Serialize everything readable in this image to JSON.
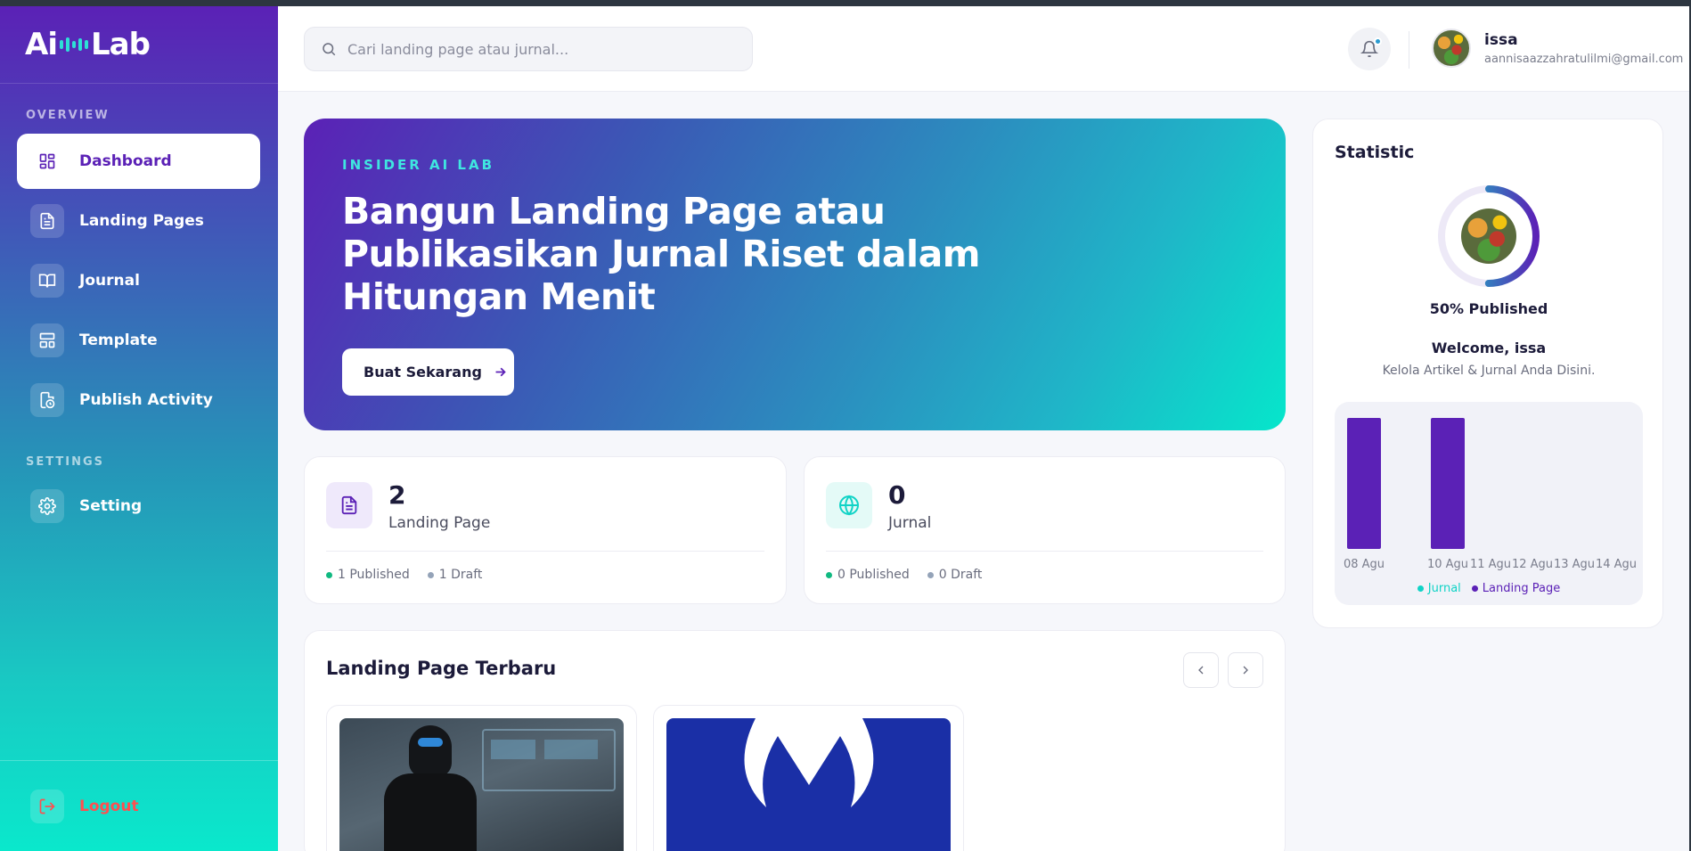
{
  "brand": {
    "name_left": "Ai",
    "name_right": "Lab"
  },
  "sidebar": {
    "overview_label": "OVERVIEW",
    "settings_label": "SETTINGS",
    "items": [
      {
        "label": "Dashboard",
        "icon": "grid-icon",
        "active": true
      },
      {
        "label": "Landing Pages",
        "icon": "file-text-icon"
      },
      {
        "label": "Journal",
        "icon": "book-open-icon"
      },
      {
        "label": "Template",
        "icon": "layout-icon"
      },
      {
        "label": "Publish Activity",
        "icon": "file-clock-icon"
      }
    ],
    "setting": {
      "label": "Setting",
      "icon": "gear-icon"
    },
    "logout": {
      "label": "Logout",
      "icon": "logout-icon"
    }
  },
  "header": {
    "search_placeholder": "Cari landing page atau jurnal...",
    "user": {
      "name": "issa",
      "email": "aannisaazzahratulilmi@gmail.com"
    }
  },
  "hero": {
    "kicker": "INSIDER AI LAB",
    "title": "Bangun Landing Page atau Publikasikan Jurnal Riset dalam Hitungan Menit",
    "button": "Buat Sekarang"
  },
  "stats": [
    {
      "count": "2",
      "label": "Landing Page",
      "published": "1 Published",
      "draft": "1 Draft"
    },
    {
      "count": "0",
      "label": "Jurnal",
      "published": "0 Published",
      "draft": "0 Draft"
    }
  ],
  "latest": {
    "title": "Landing Page Terbaru"
  },
  "statistic": {
    "title": "Statistic",
    "published_pct_label": "50% Published",
    "published_fraction": 0.5,
    "welcome": "Welcome, issa",
    "subtitle": "Kelola Artikel & Jurnal Anda Disini."
  },
  "colors": {
    "purple": "#5b21b6",
    "teal": "#10d3c6",
    "green": "#10b981",
    "gray": "#94a3b8"
  },
  "chart_data": {
    "type": "bar",
    "categories": [
      "08 Agu",
      "10 Agu",
      "11 Agu",
      "12 Agu",
      "13 Agu",
      "14 Agu"
    ],
    "series": [
      {
        "name": "Jurnal",
        "values": [
          0,
          0,
          0,
          0,
          0,
          0
        ]
      },
      {
        "name": "Landing Page",
        "values": [
          1,
          1,
          0,
          0,
          0,
          0
        ]
      }
    ],
    "ylim": [
      0,
      1
    ],
    "legend": "bottom",
    "grid": false
  }
}
